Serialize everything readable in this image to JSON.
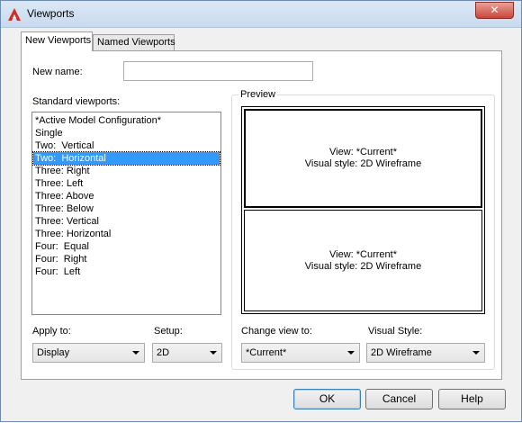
{
  "window": {
    "title": "Viewports",
    "app_icon": "autocad-icon",
    "close_glyph": "✕"
  },
  "tabs": [
    {
      "label": "New Viewports",
      "active": true
    },
    {
      "label": "Named Viewports",
      "active": false
    }
  ],
  "new_name": {
    "label": "New name:",
    "value": ""
  },
  "standard_viewports": {
    "label": "Standard viewports:",
    "items": [
      "*Active Model Configuration*",
      "Single",
      "Two:  Vertical",
      "Two:  Horizontal",
      "Three: Right",
      "Three: Left",
      "Three: Above",
      "Three: Below",
      "Three: Vertical",
      "Three: Horizontal",
      "Four:  Equal",
      "Four:  Right",
      "Four:  Left"
    ],
    "selected": "Two:  Horizontal"
  },
  "preview": {
    "label": "Preview",
    "viewports": [
      {
        "view": "View: *Current*",
        "style": "Visual style: 2D Wireframe"
      },
      {
        "view": "View: *Current*",
        "style": "Visual style: 2D Wireframe"
      }
    ]
  },
  "apply_to": {
    "label": "Apply to:",
    "value": "Display"
  },
  "setup": {
    "label": "Setup:",
    "value": "2D"
  },
  "change_view_to": {
    "label": "Change view to:",
    "value": "*Current*"
  },
  "visual_style": {
    "label": "Visual Style:",
    "value": "2D Wireframe"
  },
  "buttons": {
    "ok": "OK",
    "cancel": "Cancel",
    "help": "Help"
  }
}
